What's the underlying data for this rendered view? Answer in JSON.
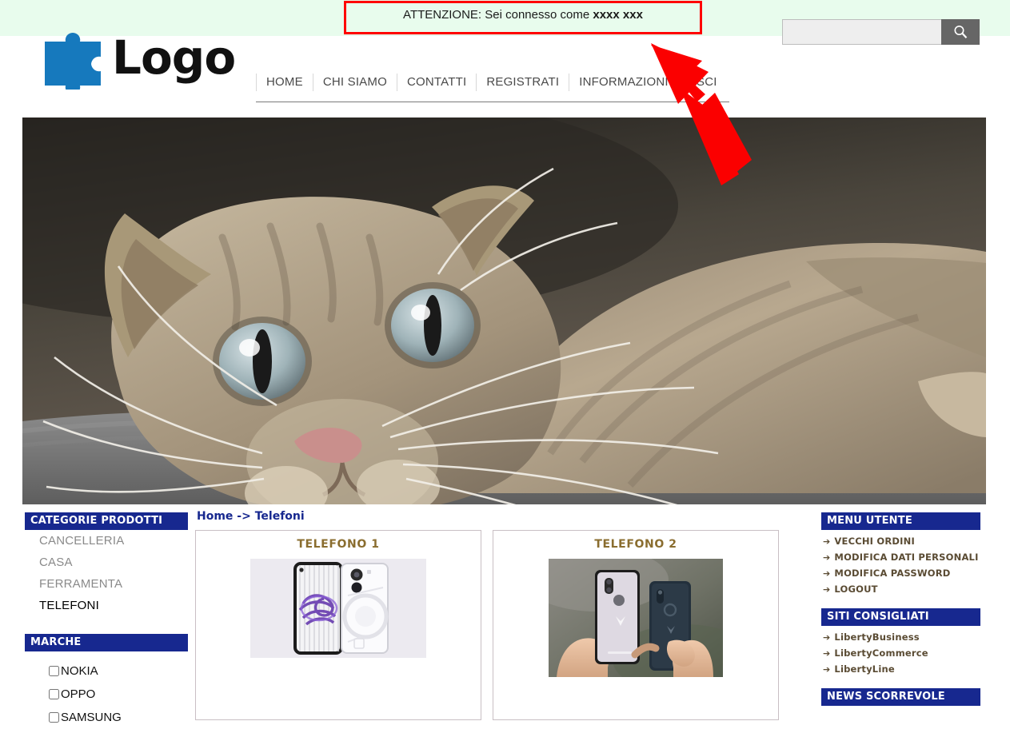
{
  "brand": {
    "logo_text": "Logo",
    "logo_icon": "puzzle-piece-icon"
  },
  "alert": {
    "prefix": "ATTENZIONE: Sei connesso come ",
    "username": "xxxx xxx",
    "border_color": "#ff0000"
  },
  "search": {
    "value": "",
    "placeholder": "",
    "button_icon": "search-icon"
  },
  "nav": {
    "items": [
      {
        "label": "HOME"
      },
      {
        "label": "CHI SIAMO"
      },
      {
        "label": "CONTATTI"
      },
      {
        "label": "REGISTRATI"
      },
      {
        "label": "INFORMAZIONI"
      },
      {
        "label": "ESCI"
      }
    ]
  },
  "banner": {
    "alt": "cat-banner-image"
  },
  "annotation": {
    "arrow_icon": "red-arrow-pointing-up-left",
    "color": "#ff0000"
  },
  "sidebar_left": {
    "categories_title": "CATEGORIE PRODOTTI",
    "categories": [
      {
        "label": "CANCELLERIA",
        "active": false
      },
      {
        "label": "CASA",
        "active": false
      },
      {
        "label": "FERRAMENTA",
        "active": false
      },
      {
        "label": "TELEFONI",
        "active": true
      }
    ],
    "brands_title": "MARCHE",
    "brands": [
      {
        "label": "NOKIA",
        "checked": false
      },
      {
        "label": "OPPO",
        "checked": false
      },
      {
        "label": "SAMSUNG",
        "checked": false
      }
    ]
  },
  "main": {
    "breadcrumb_home": "Home",
    "breadcrumb_sep": " -> ",
    "breadcrumb_current": "Telefoni",
    "products": [
      {
        "title": "TELEFONO 1",
        "image": "phone-transparent-back-product-photo"
      },
      {
        "title": "TELEFONO 2",
        "image": "two-phones-in-hands-product-photo"
      }
    ]
  },
  "sidebar_right": {
    "user_menu_title": "MENU UTENTE",
    "user_menu": [
      {
        "label": "VECCHI ORDINI"
      },
      {
        "label": "MODIFICA DATI PERSONALI"
      },
      {
        "label": "MODIFICA PASSWORD"
      },
      {
        "label": "LOGOUT"
      }
    ],
    "sites_title": "SITI CONSIGLIATI",
    "sites": [
      {
        "label": "LibertyBusiness"
      },
      {
        "label": "LibertyCommerce"
      },
      {
        "label": "LibertyLine"
      }
    ],
    "news_title": "NEWS SCORREVOLE",
    "arrow_glyph": "➔"
  },
  "colors": {
    "panel_header": "#17288f",
    "top_band": "#e8fced",
    "alert_border": "#ff0000",
    "product_title": "#8a6d2f",
    "link_muted": "#8a8a8a"
  }
}
